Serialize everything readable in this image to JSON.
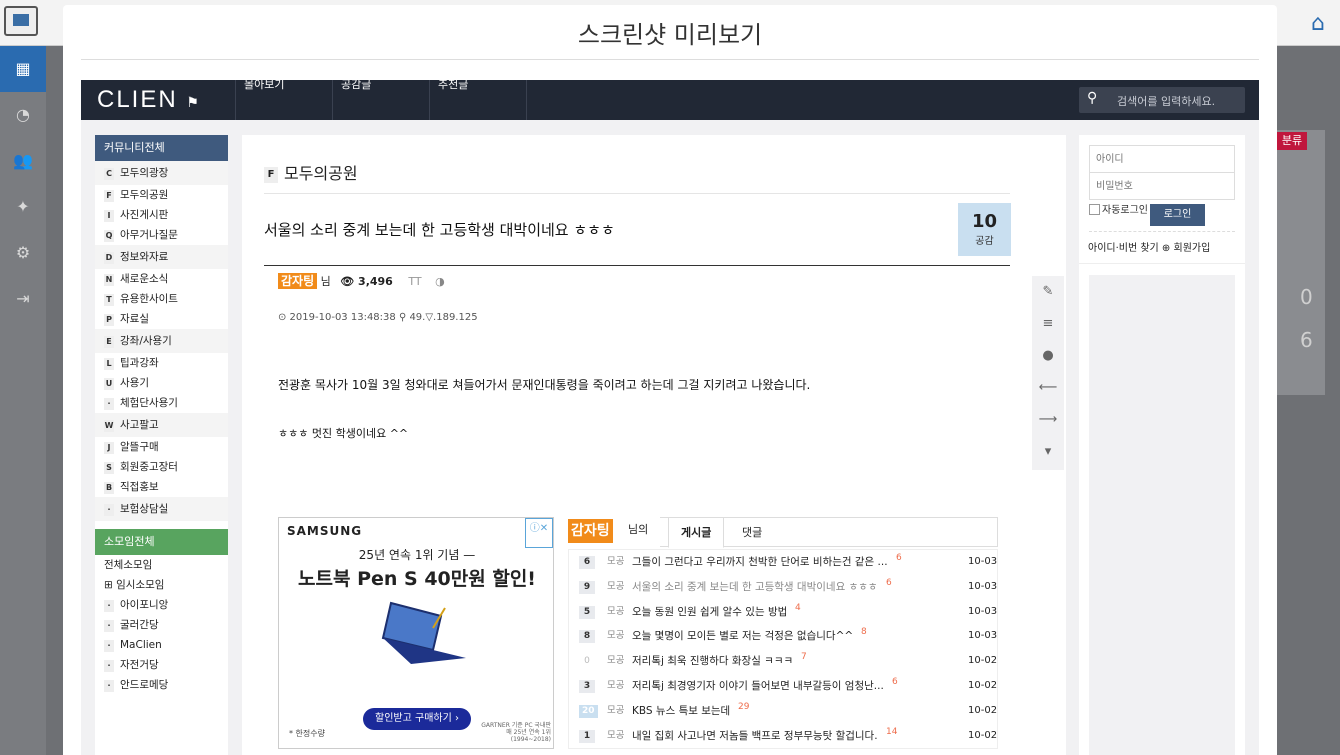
{
  "modal": {
    "title": "스크린샷 미리보기"
  },
  "bg": {
    "home_icon": "home-icon",
    "badge": "분류",
    "num1": "0",
    "num2": "6"
  },
  "clien": {
    "logo": "CLIEN",
    "nav": [
      "몰아보기",
      "공감글",
      "추천글"
    ],
    "search_placeholder": "검색어를 입력하세요."
  },
  "left_nav": {
    "header1": "커뮤니티전체",
    "groups": [
      {
        "key": "C",
        "label": "모두의광장",
        "section": true
      },
      {
        "key": "F",
        "label": "모두의공원"
      },
      {
        "key": "I",
        "label": "사진게시판"
      },
      {
        "key": "Q",
        "label": "아무거나질문"
      },
      {
        "key": "D",
        "label": "정보와자료",
        "section": true
      },
      {
        "key": "N",
        "label": "새로운소식"
      },
      {
        "key": "T",
        "label": "유용한사이트"
      },
      {
        "key": "P",
        "label": "자료실"
      },
      {
        "key": "E",
        "label": "강좌/사용기",
        "section": true
      },
      {
        "key": "L",
        "label": "팁과강좌"
      },
      {
        "key": "U",
        "label": "사용기"
      },
      {
        "key": "·",
        "label": "체험단사용기"
      },
      {
        "key": "W",
        "label": "사고팔고",
        "section": true
      },
      {
        "key": "J",
        "label": "알뜰구매"
      },
      {
        "key": "S",
        "label": "회원중고장터"
      },
      {
        "key": "B",
        "label": "직접홍보"
      },
      {
        "key": "·",
        "label": "보험상담실",
        "section": true
      }
    ],
    "header2": "소모임전체",
    "small": [
      {
        "label": "전체소모임",
        "plain": true
      },
      {
        "label": "⊞ 임시소모임",
        "plain": true
      },
      {
        "key": "·",
        "label": "아이포니앙"
      },
      {
        "key": "·",
        "label": "굴러간당"
      },
      {
        "key": "·",
        "label": "MaClien"
      },
      {
        "key": "·",
        "label": "자전거당"
      },
      {
        "key": "·",
        "label": "안드로메당"
      }
    ]
  },
  "post": {
    "board_key": "F",
    "board": "모두의공원",
    "title": "서울의 소리 중계 보는데 한 고등학생 대박이네요 ㅎㅎㅎ",
    "likes": "10",
    "likes_label": "공감",
    "nick": "감자팅",
    "nim": "님",
    "views": "👁 3,496",
    "text_size": "TT",
    "contrast": "◑",
    "meta": "⊙ 2019-10-03 13:48:38 ⚲ 49.▽.189.125",
    "body1": "전광훈 목사가 10월 3일 청와대로 쳐들어가서 문재인대통령을 죽이려고 하는데 그걸 지키려고 나왔습니다.",
    "body2": "ㅎㅎㅎ 멋진 학생이네요 ^^"
  },
  "ad": {
    "brand": "SAMSUNG",
    "line1": "25년 연속 1위 기념 —",
    "line2": "노트북 Pen S 40만원 할인!",
    "button": "할인받고 구매하기 ›",
    "foot": "* 한정수량",
    "foot2": "GARTNER 기준 PC 국내판매 25년 연속 1위 (1994~2018)",
    "close": "ⓘ✕"
  },
  "user_posts": {
    "nick": "감자팅",
    "nim": "님의",
    "tabs": [
      "게시글",
      "댓글"
    ],
    "rows": [
      {
        "count": "6",
        "tag": "모공",
        "title": "그들이 그런다고 우리까지 천박한 단어로 비하는건 같은 ...",
        "comments": "6",
        "date": "10-03"
      },
      {
        "count": "9",
        "tag": "모공",
        "title": "서울의 소리 중계 보는데 한 고등학생 대박이네요 ㅎㅎㅎ",
        "comments": "6",
        "date": "10-03",
        "current": true
      },
      {
        "count": "5",
        "tag": "모공",
        "title": "오늘 동원 인원 쉽게 알수 있는 방법",
        "comments": "4",
        "date": "10-03"
      },
      {
        "count": "8",
        "tag": "모공",
        "title": "오늘 몇명이 모이든 별로 저는 걱정은 없습니다^^",
        "comments": "8",
        "date": "10-03"
      },
      {
        "count": "0",
        "tag": "모공",
        "title": "저리톡j 최욱 진행하다 화장실 ㅋㅋㅋ",
        "comments": "7",
        "date": "10-02",
        "zero": true
      },
      {
        "count": "3",
        "tag": "모공",
        "title": "저리톡j 최경영기자 이야기 들어보면 내부갈등이 엄청난...",
        "comments": "6",
        "date": "10-02"
      },
      {
        "count": "20",
        "tag": "모공",
        "title": "KBS 뉴스 특보 보는데",
        "comments": "29",
        "date": "10-02",
        "blue": true
      },
      {
        "count": "1",
        "tag": "모공",
        "title": "내일 집회 사고나면 저놈들 백프로 정부무능탓 할겁니다.",
        "comments": "14",
        "date": "10-02"
      }
    ]
  },
  "login": {
    "id_placeholder": "아이디",
    "pw_placeholder": "비밀번호",
    "auto": "자동로그인",
    "button": "로그인",
    "links": "아이디·비번 찾기 ⊕ 회원가입"
  }
}
